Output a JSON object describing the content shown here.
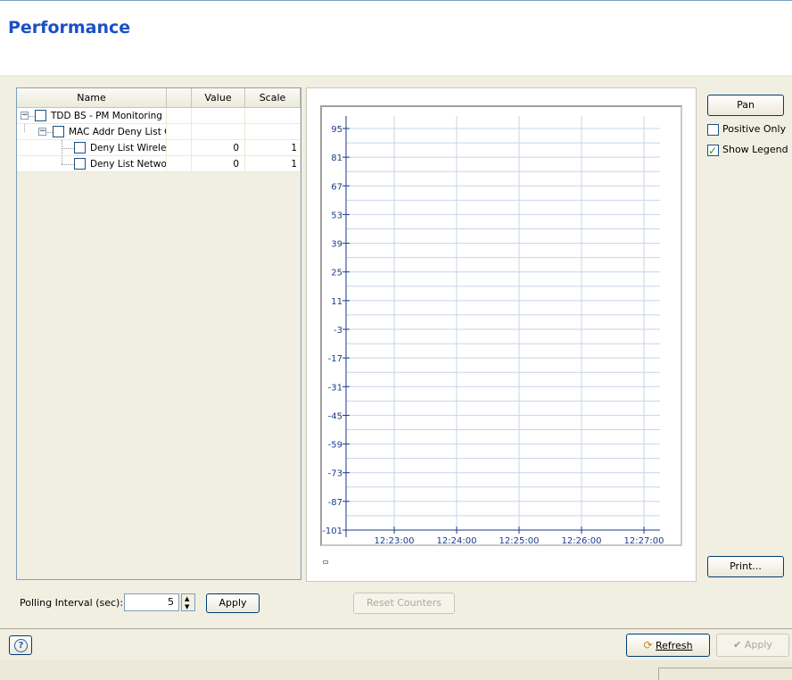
{
  "page": {
    "title": "Performance"
  },
  "tree": {
    "columns": [
      "Name",
      "",
      "Value",
      "Scale"
    ],
    "rows": [
      {
        "name": "TDD BS - PM Monitoring",
        "value": "",
        "scale": ""
      },
      {
        "name": "MAC Addr Deny List C",
        "value": "",
        "scale": ""
      },
      {
        "name": "Deny List Wireless",
        "value": "0",
        "scale": "1"
      },
      {
        "name": "Deny List Network",
        "value": "0",
        "scale": "1"
      }
    ]
  },
  "chart_data": {
    "type": "line",
    "y_ticks": [
      "95",
      "81",
      "67",
      "53",
      "39",
      "25",
      "11",
      "-3",
      "-17",
      "-31",
      "-45",
      "-59",
      "-73",
      "-87",
      "-101"
    ],
    "x_ticks": [
      "12:23:00",
      "12:24:00",
      "12:25:00",
      "12:26:00",
      "12:27:00"
    ],
    "ylim": [
      -101,
      95
    ],
    "series": [],
    "grid": true
  },
  "controls": {
    "pan_label": "Pan",
    "positive_only_label": "Positive Only",
    "positive_only_checked": false,
    "show_legend_label": "Show Legend",
    "show_legend_checked": true,
    "print_label": "Print..."
  },
  "polling": {
    "label": "Polling Interval (sec):",
    "value": "5",
    "apply_label": "Apply"
  },
  "reset_counters_label": "Reset Counters",
  "footer": {
    "help_symbol": "?",
    "refresh_label": "Refresh",
    "apply_label": "Apply"
  },
  "colors": {
    "title": "#1a4fc7",
    "grid": "#c8d4e8",
    "axis": "#1a3a8a"
  }
}
